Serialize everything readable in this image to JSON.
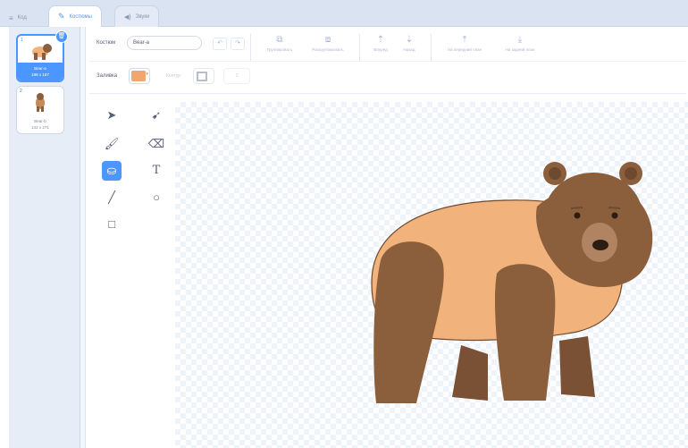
{
  "tabs": {
    "code": "Код",
    "costumes": "Костюмы",
    "sounds": "Звуки"
  },
  "costumes": [
    {
      "index": "1",
      "name": "Bear-a",
      "size": "198 x 167"
    },
    {
      "index": "2",
      "name": "Bear-b",
      "size": "142 x 271"
    }
  ],
  "toolbar": {
    "costume_label": "Костюм",
    "costume_name": "Bear-a",
    "undo_icon": "undo-icon",
    "redo_icon": "redo-icon",
    "group": "Группировать",
    "ungroup": "Разгруппировать",
    "forward": "Вперёд",
    "backward": "Назад",
    "front": "На передний план",
    "back": "На задний план",
    "fill_label": "Заливка",
    "outline_label": "Контур",
    "outline_width": "1"
  },
  "colors": {
    "accent": "#4c97ff",
    "fill": "#f0a66e",
    "bear_dark": "#8b5e3c",
    "bear_body": "#f2b27c"
  },
  "tools": [
    {
      "name": "select",
      "icon": "arrow-select-icon"
    },
    {
      "name": "reshape",
      "icon": "reshape-icon"
    },
    {
      "name": "brush",
      "icon": "brush-icon"
    },
    {
      "name": "eraser",
      "icon": "eraser-icon"
    },
    {
      "name": "fill",
      "icon": "fill-bucket-icon",
      "active": true
    },
    {
      "name": "text",
      "icon": "text-icon"
    },
    {
      "name": "line",
      "icon": "line-icon"
    },
    {
      "name": "circle",
      "icon": "circle-icon"
    },
    {
      "name": "rectangle",
      "icon": "rectangle-icon"
    }
  ]
}
